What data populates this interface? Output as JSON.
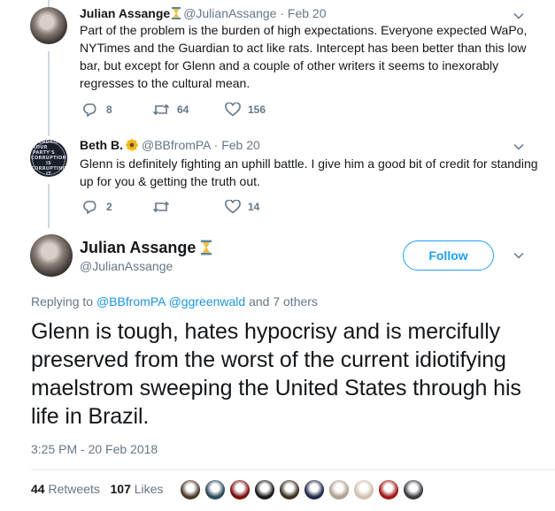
{
  "tweet1": {
    "name": "Julian Assange",
    "handle": "@JulianAssange",
    "separator": "·",
    "date": "Feb 20",
    "text": "Part of the problem is the burden of high expectations. Everyone expected WaPo, NYTimes and the Guardian to act like rats. Intercept has been better than this low bar, but except for Glenn and a couple of other writers it seems to inexorably regresses to the cultural mean.",
    "replies": "8",
    "retweets": "64",
    "likes": "156"
  },
  "tweet2": {
    "name": "Beth B.",
    "handle": "@BBfromPA",
    "separator": "·",
    "date": "Feb 20",
    "text": "Glenn is definitely fighting an uphill battle. I give him a good bit of credit for standing up for you & getting the truth out.",
    "replies": "2",
    "retweets": "",
    "likes": "14",
    "avatar_text": [
      "SUNDRING",
      "YOUR PARTY'S",
      "CORRUPTION",
      "IS",
      "CORRUPTING",
      "IT"
    ]
  },
  "main": {
    "name": "Julian Assange",
    "handle": "@JulianAssange",
    "follow_label": "Follow",
    "replying_prefix": "Replying to",
    "replying_user1": "@BBfromPA",
    "replying_user2": "@ggreenwald",
    "replying_suffix": "and 7 others",
    "text": "Glenn is tough, hates hypocrisy and is mercifully preserved from the worst of the current idiotifying maelstrom sweeping the United States through his life in Brazil.",
    "timestamp": "3:25 PM - 20 Feb 2018",
    "retweets_count": "44",
    "retweets_label": "Retweets",
    "likes_count": "107",
    "likes_label": "Likes"
  },
  "colors": {
    "accent": "#1da1f2",
    "text": "#14171a",
    "muted": "#657786"
  },
  "icons": [
    "chevron-down-icon",
    "reply-icon",
    "retweet-icon",
    "like-icon",
    "hourglass-icon",
    "sunflower-icon"
  ],
  "likers": [
    {
      "color": "#4a3a2a"
    },
    {
      "color": "#2b4a5a"
    },
    {
      "color": "#7a1010"
    },
    {
      "color": "#1a1a1a"
    },
    {
      "color": "#3a3020"
    },
    {
      "color": "#20284a"
    },
    {
      "color": "#b0a090"
    },
    {
      "color": "#d0c0b0"
    },
    {
      "color": "#a01818"
    },
    {
      "color": "#3a3a40"
    }
  ]
}
